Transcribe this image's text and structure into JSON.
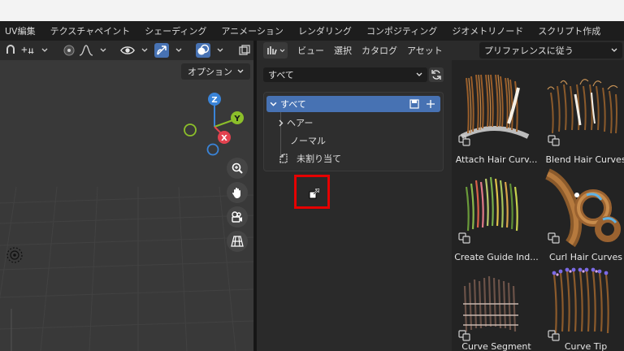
{
  "menubar": {
    "tabs": [
      "UV編集",
      "テクスチャペイント",
      "シェーディング",
      "アニメーション",
      "レンダリング",
      "コンポジティング",
      "ジオメトリノード",
      "スクリプト作成"
    ]
  },
  "viewport": {
    "options_label": "オプション",
    "gizmo": {
      "z": "Z",
      "y": "Y",
      "x": "X"
    }
  },
  "asset_browser": {
    "header": {
      "menus": [
        "ビュー",
        "選択",
        "カタログ",
        "アセット"
      ],
      "import_method": "プリファレンスに従う"
    },
    "library": "すべて",
    "catalog": {
      "root": "すべて",
      "items": [
        {
          "label": "ヘアー",
          "expandable": true
        },
        {
          "label": "ノーマル",
          "expandable": false
        }
      ],
      "unassigned": "未割り当て"
    },
    "assets": [
      {
        "label": "Attach Hair Curv..."
      },
      {
        "label": "Blend Hair Curves"
      },
      {
        "label": "Create Guide Ind..."
      },
      {
        "label": "Curl Hair Curves"
      },
      {
        "label": "Curve Segment"
      },
      {
        "label": "Curve Tip"
      }
    ]
  },
  "colors": {
    "accent": "#4772b3",
    "highlight_box": "#e50000",
    "axis_x": "#e2424f",
    "axis_y": "#8cbf2a",
    "axis_z": "#3a84d8"
  }
}
